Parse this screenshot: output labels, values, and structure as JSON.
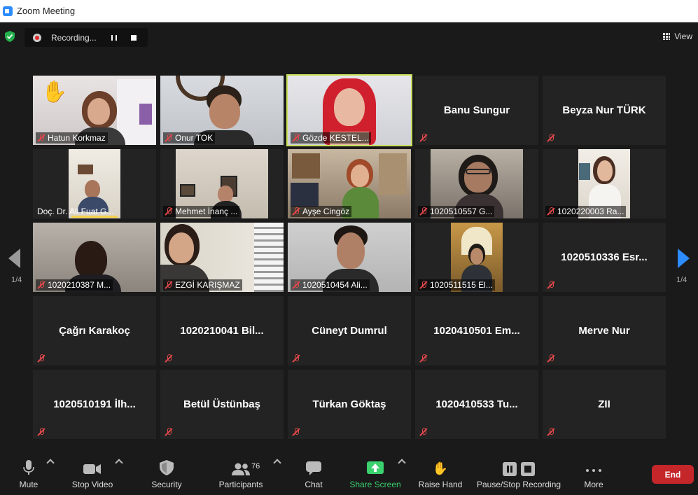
{
  "window": {
    "title": "Zoom Meeting"
  },
  "recording": {
    "label": "Recording..."
  },
  "view": {
    "label": "View"
  },
  "pagination": {
    "left": "1/4",
    "right": "1/4"
  },
  "participants_grid": [
    {
      "name": "Hatun Korkmaz",
      "video": true,
      "hand_raised": true
    },
    {
      "name": "Onur TOK",
      "video": true
    },
    {
      "name": "Gözde KESTEL...",
      "video": true,
      "active_speaker": true
    },
    {
      "name": "Banu Sungur",
      "video": false
    },
    {
      "name": "Beyza Nur TÜRK",
      "video": false
    },
    {
      "name": "Doç. Dr. Ali Fuat G...",
      "video": true
    },
    {
      "name": "Mehmet İnanç ...",
      "video": true
    },
    {
      "name": "Ayşe Cingöz",
      "video": true
    },
    {
      "name": "1020510557 G...",
      "video": true
    },
    {
      "name": "1020220003 Ra...",
      "video": true
    },
    {
      "name": "1020210387 M...",
      "video": true
    },
    {
      "name": "EZGİ  KARIŞMAZ",
      "video": true
    },
    {
      "name": "1020510454 Ali...",
      "video": true
    },
    {
      "name": "1020511515  El...",
      "video": true
    },
    {
      "name": "1020510336 Esr...",
      "video": false
    },
    {
      "name": "Çağrı Karakoç",
      "video": false
    },
    {
      "name": "1020210041 Bil...",
      "video": false
    },
    {
      "name": "Cüneyt Dumrul",
      "video": false
    },
    {
      "name": "1020410501 Em...",
      "video": false
    },
    {
      "name": "Merve Nur",
      "video": false
    },
    {
      "name": "1020510191 İlh...",
      "video": false
    },
    {
      "name": "Betül Üstünbaş",
      "video": false
    },
    {
      "name": "Türkan Göktaş",
      "video": false
    },
    {
      "name": "1020410533 Tu...",
      "video": false
    },
    {
      "name": "ZII",
      "video": false
    }
  ],
  "toolbar": {
    "mute": "Mute",
    "stop_video": "Stop Video",
    "security": "Security",
    "participants": "Participants",
    "participants_count": "76",
    "chat": "Chat",
    "share_screen": "Share Screen",
    "raise_hand": "Raise Hand",
    "pause_stop_recording": "Pause/Stop Recording",
    "more": "More",
    "end": "End"
  },
  "colors": {
    "share_green": "#3ad16e",
    "end_red": "#c4262a",
    "active_border": "#c8e05a",
    "accent_blue": "#2d8cff",
    "muted_red": "#e0484a"
  }
}
